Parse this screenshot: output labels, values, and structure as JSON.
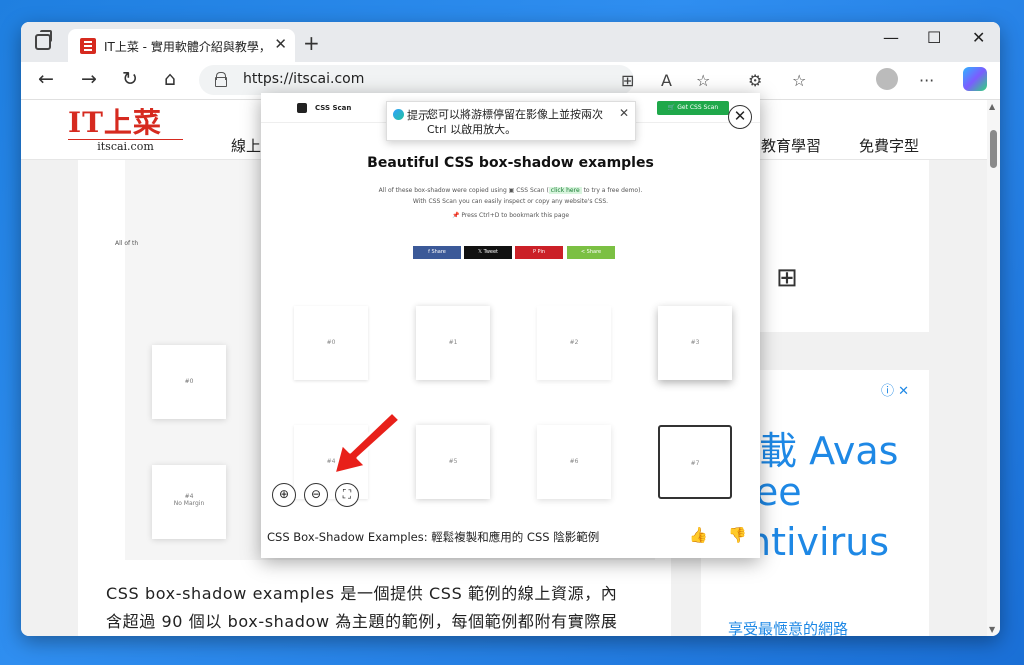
{
  "browser": {
    "tab_title": "IT上菜 - 實用軟體介紹與教學，幫",
    "tab_close": "✕",
    "new_tab": "+",
    "window_controls": {
      "minimize": "—",
      "maximize": "☐",
      "close": "✕"
    },
    "url": "https://itscai.com",
    "nav": {
      "back": "←",
      "forward": "→",
      "reload": "↻",
      "home": "⌂"
    },
    "toolbar_icons": {
      "apps": "⊞",
      "read_aloud": "A",
      "favorite": "☆",
      "extensions": "⚙",
      "favorites": "☆",
      "more": "···"
    }
  },
  "site": {
    "logo_big": "IT上菜",
    "logo_small": "itscai.com",
    "menu": [
      "線上",
      "教育學習",
      "免費字型"
    ]
  },
  "article": {
    "line1": "CSS box-shadow examples 是一個提供 CSS 範例的線上資源，內",
    "line2": "含超過 90 個以 box-shadow 為主題的範例，每個範例都附有實際展"
  },
  "ad": {
    "line1": "下載 Avas",
    "line2": "Free",
    "line3": "Antivirus",
    "footer": "享受最愜意的網路",
    "close": "ⓘ ✕"
  },
  "preview_bg": {
    "label_left": "All of th",
    "box0": "#0",
    "box4": "#4",
    "box4_sub": "No Margin"
  },
  "overlay": {
    "logo_text": "CSS Scan",
    "get_button": "🛒 Get CSS Scan",
    "tooltip_label": "提示:",
    "tooltip_text": "您可以將游標停留在影像上並按兩次 Ctrl 以啟用放大。",
    "close": "✕",
    "title": "Beautiful CSS box-shadow examples",
    "sub1": "All of these box-shadow were copied using",
    "sub_scan": "CSS Scan",
    "sub_click": "click here",
    "sub_tail": "to try a free demo).",
    "sub2": "With CSS Scan you can easily inspect or copy any website's CSS.",
    "press": "📌 Press  Ctrl+D  to bookmark this page",
    "share": [
      {
        "label": "f  Share",
        "color": "#3b5998"
      },
      {
        "label": "𝕏  Tweet",
        "color": "#111111"
      },
      {
        "label": "P  Pin",
        "color": "#cb2027"
      },
      {
        "label": "<  Share",
        "color": "#7bc043"
      }
    ],
    "boxes": [
      "#0",
      "#1",
      "#2",
      "#3",
      "#4",
      "#5",
      "#6",
      "#7"
    ],
    "zoom_in": "⊕",
    "zoom_out": "⊖",
    "fit": "⛶",
    "caption": "CSS Box-Shadow Examples: 輕鬆複製和應用的 CSS 陰影範例",
    "like": "👍",
    "dislike": "👎"
  },
  "colors": {
    "accent": "#d62a1f",
    "ad_blue": "#1e88e5",
    "arrow": "#e8201a"
  }
}
